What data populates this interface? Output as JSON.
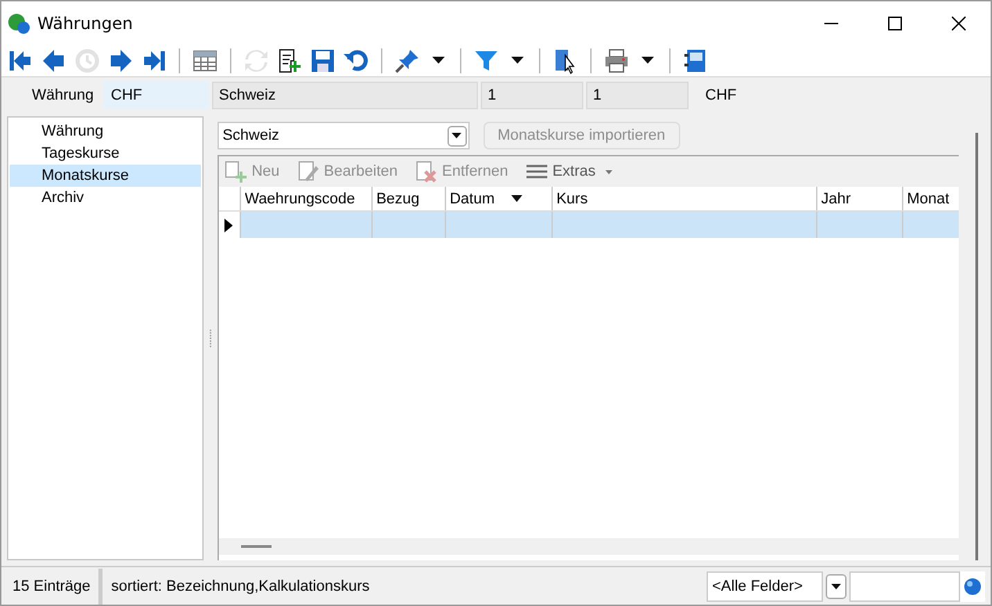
{
  "window": {
    "title": "Währungen"
  },
  "toolbar": [
    [
      {
        "disabled": false
      },
      {
        "disabled": false
      },
      {
        "disabled": true
      },
      {
        "disabled": false
      },
      {
        "disabled": false
      }
    ],
    [
      {
        "disabled": false
      }
    ],
    [
      {
        "disabled": true
      },
      {
        "disabled": false
      },
      {
        "disabled": false
      },
      {
        "disabled": false
      }
    ],
    [
      {
        "disabled": false,
        "dropdown": true
      }
    ],
    [
      {
        "disabled": false,
        "dropdown": true
      }
    ],
    [
      {
        "disabled": false
      }
    ],
    [
      {
        "disabled": false,
        "dropdown": true
      }
    ],
    [
      {
        "disabled": false
      }
    ]
  ],
  "header": {
    "label": "Währung",
    "code": "CHF",
    "name": "Schweiz",
    "value_1": "1",
    "value_2": "1",
    "unit": "CHF"
  },
  "sidebar": {
    "items": [
      {
        "label": "Währung",
        "selected": false
      },
      {
        "label": "Tageskurse",
        "selected": false
      },
      {
        "label": "Monatskurse",
        "selected": true
      },
      {
        "label": "Archiv",
        "selected": false
      }
    ]
  },
  "country_select": {
    "value": "Schweiz"
  },
  "import_button": {
    "label": "Monatskurse importieren",
    "disabled": true
  },
  "grid_toolbar": [
    {
      "label": "Neu",
      "disabled": true
    },
    {
      "label": "Bearbeiten",
      "disabled": true
    },
    {
      "label": "Entfernen",
      "disabled": true
    },
    {
      "label": "Extras",
      "disabled": false,
      "dropdown": true
    }
  ],
  "table": {
    "columns": [
      {
        "label": "Waehrungscode",
        "sorted": false
      },
      {
        "label": "Bezug",
        "sorted": false
      },
      {
        "label": "Datum",
        "sorted": true
      },
      {
        "label": "Kurs",
        "sorted": false
      },
      {
        "label": "Jahr",
        "sorted": false
      },
      {
        "label": "Monat",
        "sorted": false
      }
    ],
    "rows": [
      {
        "selected": true
      }
    ]
  },
  "status_bar": {
    "count": "15 Einträge",
    "sort": "sortiert: Bezeichnung,Kalkulationskurs",
    "field_select": "<Alle Felder>"
  }
}
